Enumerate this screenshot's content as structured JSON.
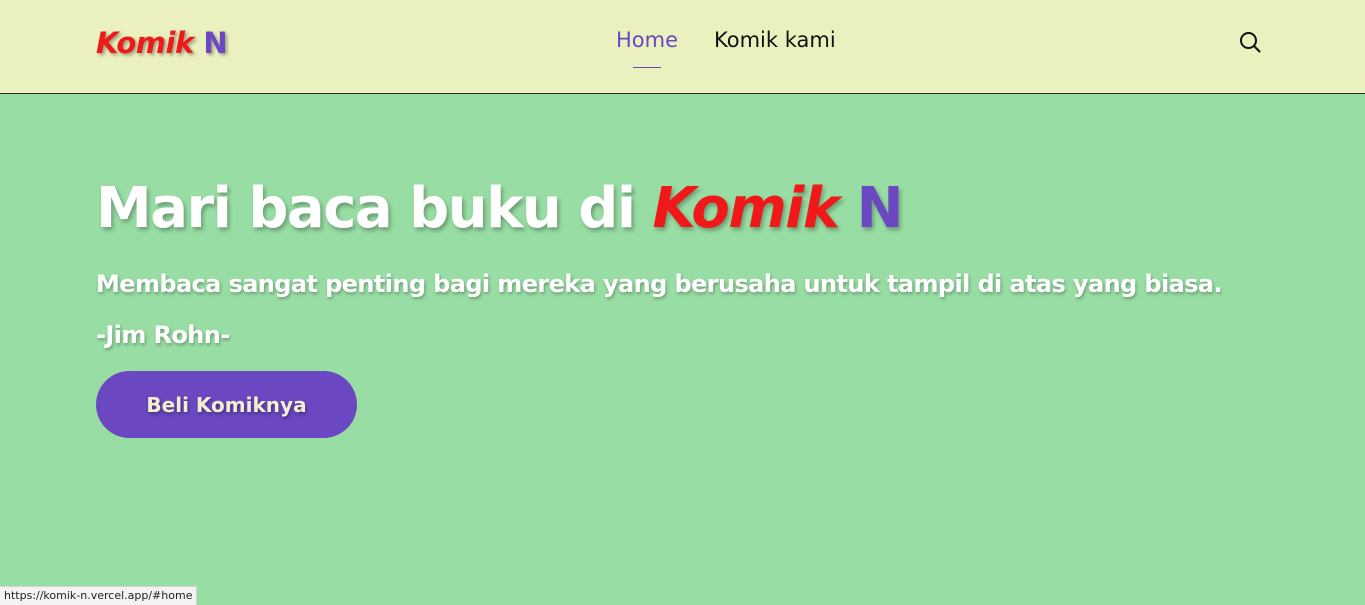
{
  "navbar": {
    "logo_part1": "Komik",
    "logo_part2": "N",
    "links": [
      {
        "label": "Home",
        "active": true
      },
      {
        "label": "Komik kami",
        "active": false
      }
    ],
    "search_icon": "search-icon"
  },
  "hero": {
    "title_prefix": "Mari baca buku di ",
    "title_brand1": "Komik",
    "title_brand2": "N",
    "quote": "Membaca sangat penting bagi mereka yang berusaha untuk tampil di atas yang biasa.",
    "author": "-Jim Rohn-",
    "cta_label": "Beli Komiknya"
  },
  "status_bar": {
    "url": "https://komik-n.vercel.app/#home"
  },
  "colors": {
    "navbar_bg": "#eaf0be",
    "hero_bg": "#98dea4",
    "brand_red": "#f01818",
    "brand_purple": "#6c47c2",
    "cta_text": "#f6eccf"
  }
}
